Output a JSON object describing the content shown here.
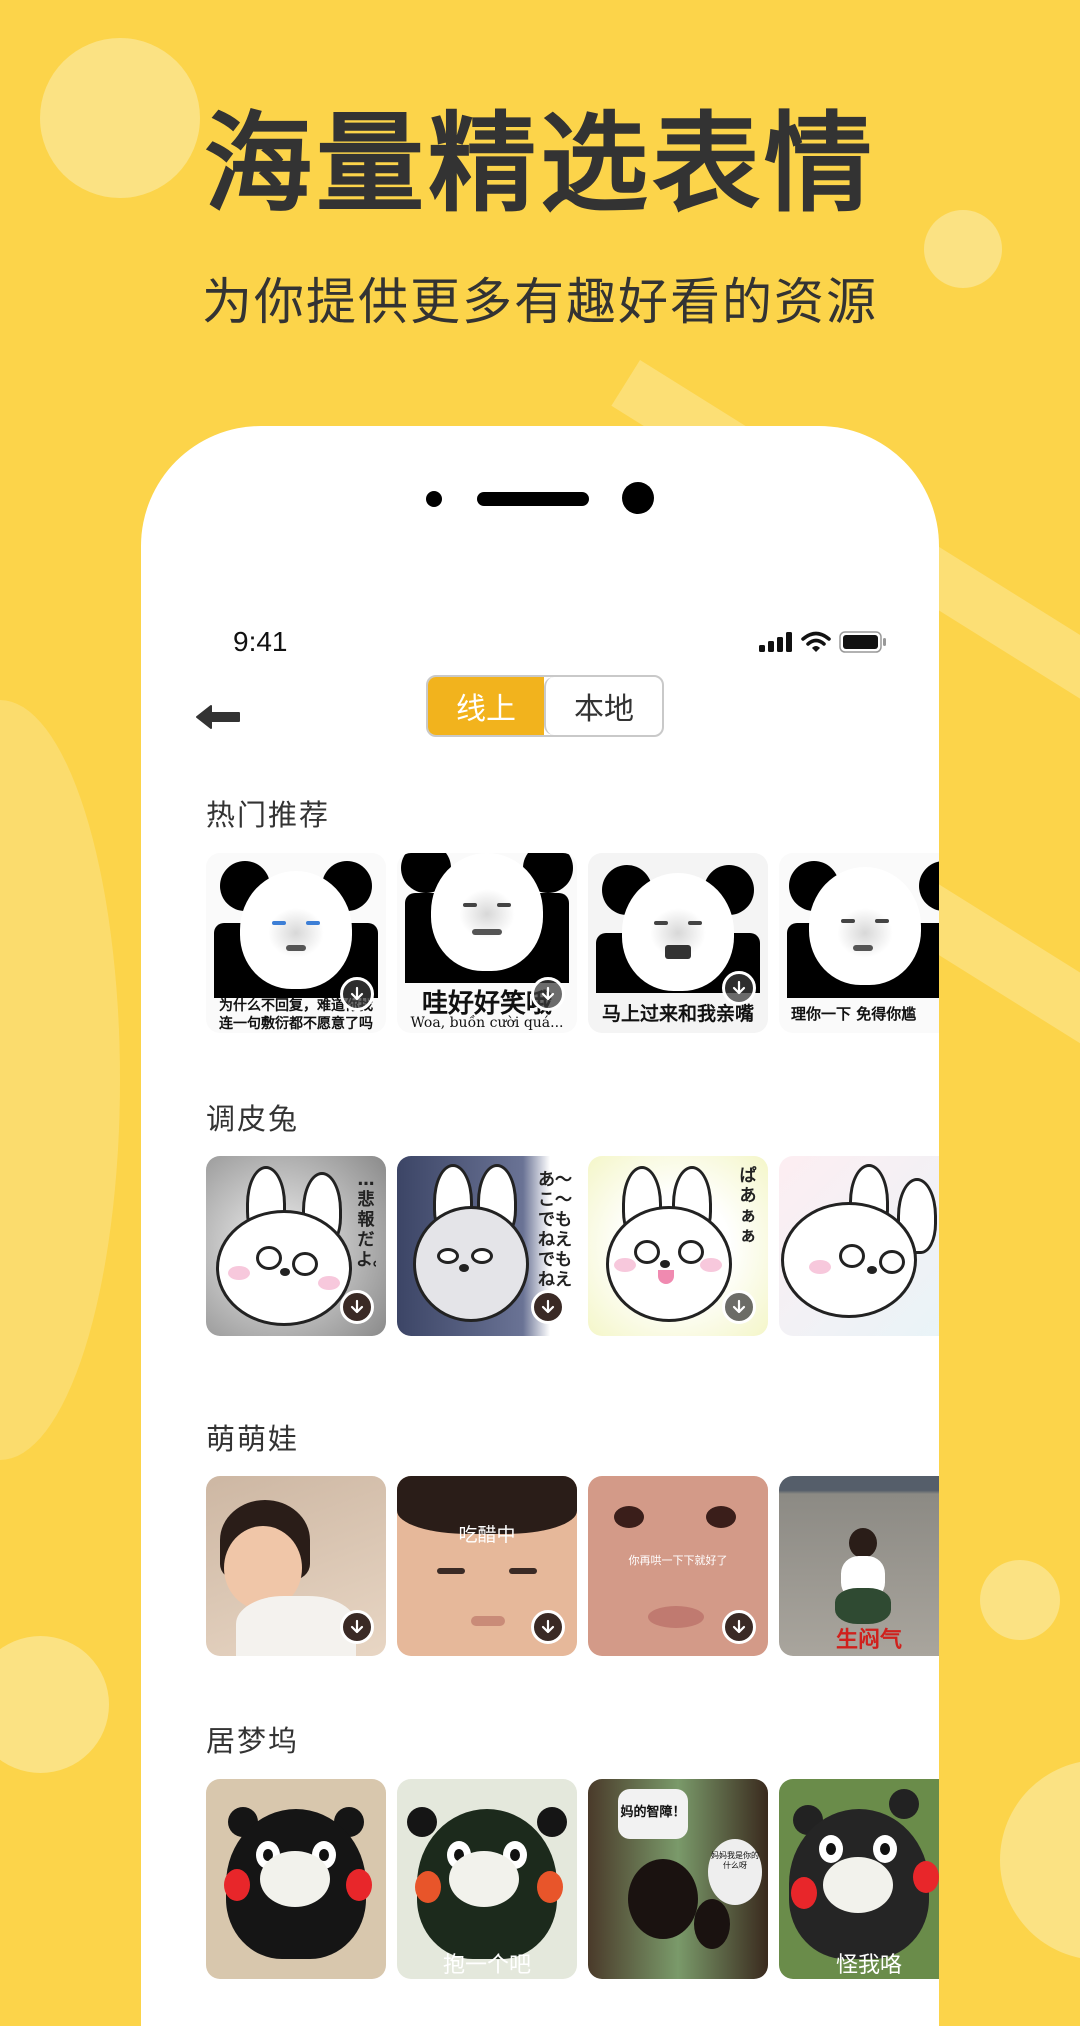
{
  "promo": {
    "headline": "海量精选表情",
    "subline": "为你提供更多有趣好看的资源"
  },
  "status_bar": {
    "time": "9:41",
    "icons": [
      "signal-icon",
      "wifi-icon",
      "battery-icon"
    ]
  },
  "nav": {
    "back_icon": "arrow-left-icon",
    "toggle": [
      {
        "label": "线上",
        "active": true
      },
      {
        "label": "本地",
        "active": false
      }
    ]
  },
  "colors": {
    "background": "#fcd44a",
    "accent": "#f2b31d",
    "text": "#333333"
  },
  "sections": [
    {
      "title": "热门推荐",
      "items": [
        {
          "caption": "为什么不回复，难道你找 连一句敷衍都不愿意了吗",
          "caption_line1": "为什么不回复，难道你找",
          "caption_line2": "连一句敷衍都不愿意了吗"
        },
        {
          "caption_line1": "哇好好笑哦",
          "caption_line2": "Woa, buồn cười quá..."
        },
        {
          "caption_line1": "马上过来和我亲嘴"
        },
        {
          "caption_line1": "理你一下 免得你尴"
        }
      ]
    },
    {
      "title": "调皮兔",
      "items": [
        {
          "caption_line1": "…悲報だよ。"
        },
        {
          "caption_line1": "あ〜こ〜でもねえでもねえ"
        },
        {
          "caption_line1": "ぱあぁぁ"
        },
        {
          "caption_line1": ""
        }
      ]
    },
    {
      "title": "萌萌娃",
      "items": [
        {
          "caption_line1": ""
        },
        {
          "caption_line1": "吃醋中"
        },
        {
          "caption_line1": "你再哄一下下就好了"
        },
        {
          "caption_line1": "生闷气"
        }
      ]
    },
    {
      "title": "居梦坞",
      "items": [
        {
          "caption_line1": ""
        },
        {
          "caption_line1": "抱一个吧"
        },
        {
          "caption_line1": "妈的智障！",
          "caption_line2": "妈妈我是你的什么呀"
        },
        {
          "caption_line1": "怪我咯"
        }
      ]
    }
  ]
}
